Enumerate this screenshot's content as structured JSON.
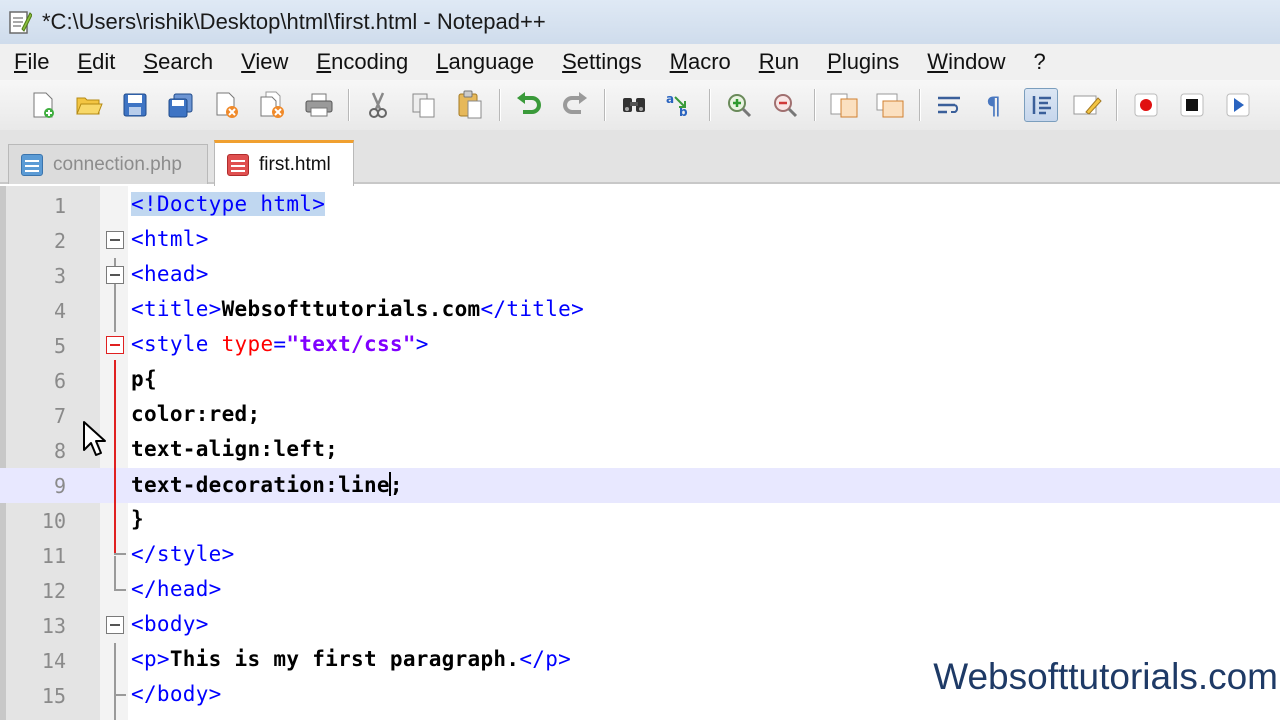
{
  "window": {
    "title": "*C:\\Users\\rishik\\Desktop\\html\\first.html - Notepad++"
  },
  "menu": [
    "File",
    "Edit",
    "Search",
    "View",
    "Encoding",
    "Language",
    "Settings",
    "Macro",
    "Run",
    "Plugins",
    "Window",
    "?"
  ],
  "toolbar": {
    "icons": [
      "new-file-icon",
      "open-file-icon",
      "save-icon",
      "save-all-icon",
      "close-icon",
      "close-all-icon",
      "print-icon",
      "cut-icon",
      "copy-icon",
      "paste-icon",
      "undo-icon",
      "redo-icon",
      "find-icon",
      "replace-icon",
      "zoom-in-icon",
      "zoom-out-icon",
      "sync-vertical-icon",
      "sync-horizontal-icon",
      "word-wrap-icon",
      "show-all-characters-icon",
      "indent-guide-icon",
      "user-defined-language-icon",
      "record-macro-icon",
      "stop-recording-icon",
      "play-macro-icon"
    ]
  },
  "tabs": [
    {
      "label": "connection.php",
      "active": false
    },
    {
      "label": "first.html",
      "active": true
    }
  ],
  "editor": {
    "current_line": 9,
    "lines": [
      {
        "n": "1",
        "parts": [
          {
            "t": "<!Doctype html>",
            "c": "tag hl"
          }
        ]
      },
      {
        "n": "2",
        "parts": [
          {
            "t": "<html>",
            "c": "tag"
          }
        ]
      },
      {
        "n": "3",
        "parts": [
          {
            "t": "<head>",
            "c": "tag"
          }
        ]
      },
      {
        "n": "4",
        "parts": [
          {
            "t": "<title>",
            "c": "tag"
          },
          {
            "t": "Websofttutorials.com",
            "c": "bold"
          },
          {
            "t": "</title>",
            "c": "tag"
          }
        ]
      },
      {
        "n": "5",
        "parts": [
          {
            "t": "<style ",
            "c": "tag"
          },
          {
            "t": "type",
            "c": "attr"
          },
          {
            "t": "=",
            "c": "tag"
          },
          {
            "t": "\"text/css\"",
            "c": "str"
          },
          {
            "t": ">",
            "c": "tag"
          }
        ]
      },
      {
        "n": "6",
        "parts": [
          {
            "t": "p{",
            "c": "bold"
          }
        ]
      },
      {
        "n": "7",
        "parts": [
          {
            "t": "color:red;",
            "c": "bold"
          }
        ]
      },
      {
        "n": "8",
        "parts": [
          {
            "t": "text-align:left;",
            "c": "bold"
          }
        ]
      },
      {
        "n": "9",
        "parts": [
          {
            "t": "text-decoration:line",
            "c": "bold"
          },
          {
            "t": "",
            "c": "caret"
          },
          {
            "t": ";",
            "c": "bold"
          }
        ]
      },
      {
        "n": "10",
        "parts": [
          {
            "t": "}",
            "c": "bold"
          }
        ]
      },
      {
        "n": "11",
        "parts": [
          {
            "t": "</style>",
            "c": "tag"
          }
        ]
      },
      {
        "n": "12",
        "parts": [
          {
            "t": "</head>",
            "c": "tag"
          }
        ]
      },
      {
        "n": "13",
        "parts": [
          {
            "t": "<body>",
            "c": "tag"
          }
        ]
      },
      {
        "n": "14",
        "parts": [
          {
            "t": "<p>",
            "c": "tag"
          },
          {
            "t": "This is my first paragraph.",
            "c": "bold"
          },
          {
            "t": "</p>",
            "c": "tag"
          }
        ]
      },
      {
        "n": "15",
        "parts": [
          {
            "t": "</body>",
            "c": "tag"
          }
        ]
      }
    ]
  },
  "watermark": "Websofttutorials.com",
  "colors": {
    "tag": "#0000ff",
    "attr": "#ff0000",
    "string": "#8000ff",
    "active_tab_accent": "#f0a030"
  }
}
